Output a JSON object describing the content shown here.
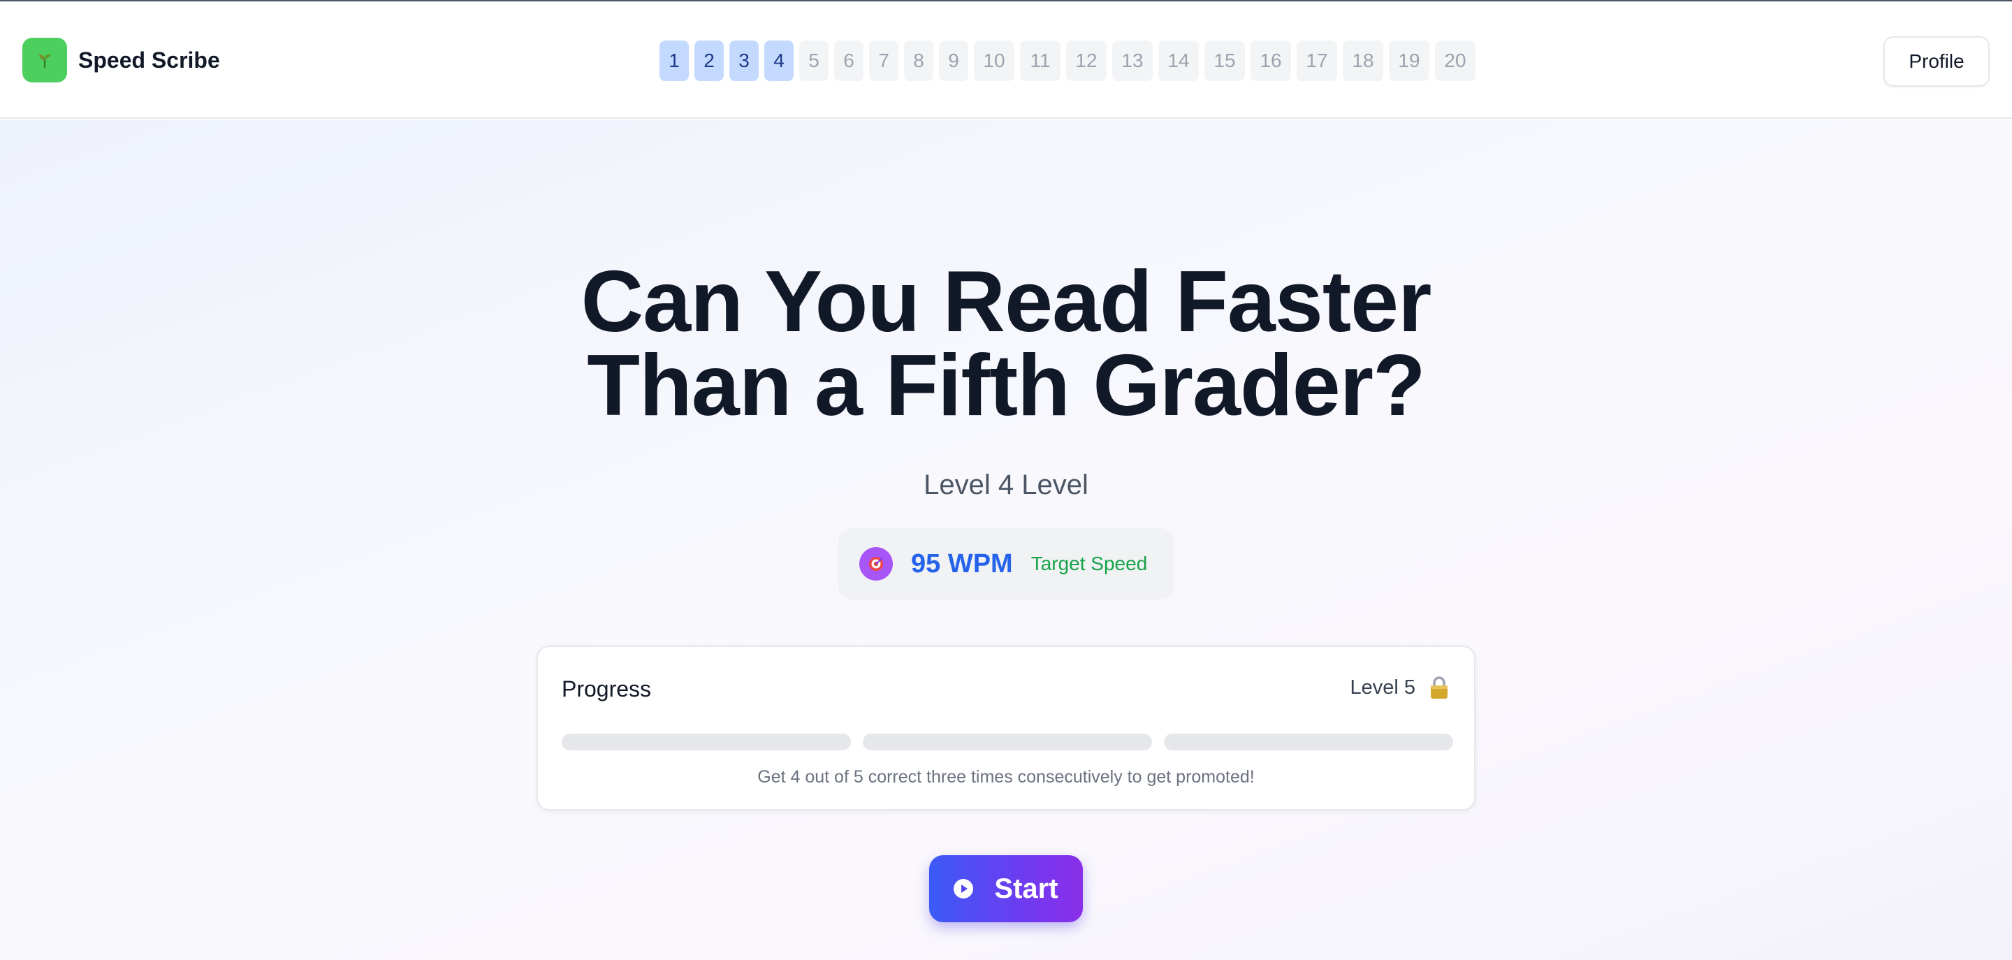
{
  "app": {
    "name": "Speed Scribe",
    "logo_icon": "sprout-icon",
    "accent_color": "#4ccf5f"
  },
  "header": {
    "levels": [
      {
        "label": "1",
        "active": true
      },
      {
        "label": "2",
        "active": true
      },
      {
        "label": "3",
        "active": true
      },
      {
        "label": "4",
        "active": true
      },
      {
        "label": "5",
        "active": false
      },
      {
        "label": "6",
        "active": false
      },
      {
        "label": "7",
        "active": false
      },
      {
        "label": "8",
        "active": false
      },
      {
        "label": "9",
        "active": false
      },
      {
        "label": "10",
        "active": false
      },
      {
        "label": "11",
        "active": false
      },
      {
        "label": "12",
        "active": false
      },
      {
        "label": "13",
        "active": false
      },
      {
        "label": "14",
        "active": false
      },
      {
        "label": "15",
        "active": false
      },
      {
        "label": "16",
        "active": false
      },
      {
        "label": "17",
        "active": false
      },
      {
        "label": "18",
        "active": false
      },
      {
        "label": "19",
        "active": false
      },
      {
        "label": "20",
        "active": false
      }
    ],
    "profile_label": "Profile"
  },
  "hero": {
    "title_line1": "Can You Read Faster",
    "title_line2": "Than a Fifth Grader?",
    "subtitle": "Level 4 Level"
  },
  "speed": {
    "icon": "target-icon",
    "wpm_text": "95 WPM",
    "label": "Target Speed"
  },
  "progress": {
    "title": "Progress",
    "next_level": "Level 5",
    "next_level_icon": "lock-icon",
    "segments": [
      0,
      0,
      0
    ],
    "hint": "Get 4 out of 5 correct three times consecutively to get promoted!"
  },
  "start": {
    "label": "Start",
    "icon": "play-icon"
  }
}
